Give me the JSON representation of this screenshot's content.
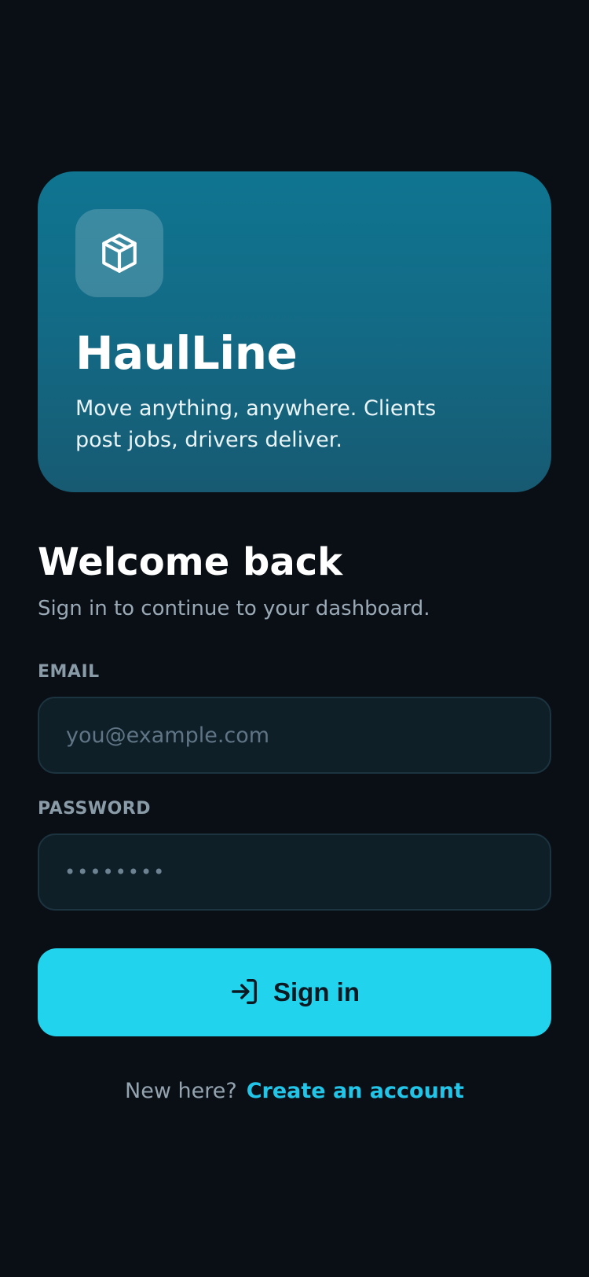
{
  "hero": {
    "icon": "package-icon",
    "brand": "HaulLine",
    "tagline": "Move anything, anywhere. Clients post jobs, drivers deliver."
  },
  "welcome": {
    "title": "Welcome back",
    "subtitle": "Sign in to continue to your dashboard."
  },
  "form": {
    "email_label": "EMAIL",
    "email_placeholder": "you@example.com",
    "email_value": "",
    "password_label": "PASSWORD",
    "password_value": "••••••••",
    "signin_icon": "login-arrow-icon",
    "signin_label": "Sign in"
  },
  "footer": {
    "prompt": "New here?",
    "link": "Create an account"
  },
  "colors": {
    "background": "#0a0f15",
    "accent": "#22d3ee",
    "hero": "#13708c"
  }
}
